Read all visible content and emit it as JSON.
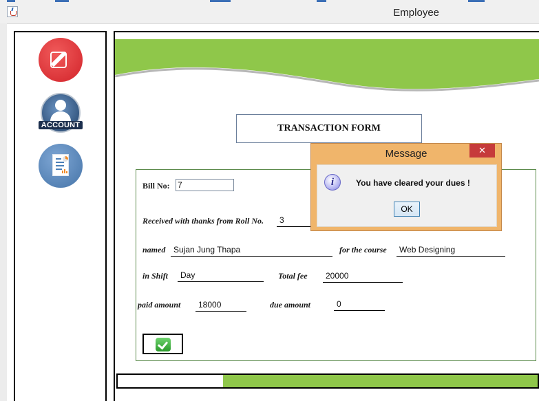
{
  "window": {
    "title": "Employee"
  },
  "sidebar": {
    "items": [
      {
        "name": "edit",
        "icon": "edit-icon"
      },
      {
        "name": "account",
        "icon": "account-icon",
        "label": "ACCOUNT"
      },
      {
        "name": "report",
        "icon": "report-icon"
      }
    ]
  },
  "form": {
    "title": "TRANSACTION FORM",
    "bill_label": "Bill No:",
    "bill_value": "7",
    "received_label": "Received with thanks from  Roll No.",
    "roll_value": "3",
    "named_label": "named",
    "name_value": "Sujan  Jung Thapa",
    "course_label": "for the course",
    "course_value": "Web Designing",
    "shift_label": "in Shift",
    "shift_value": "Day",
    "total_fee_label": "Total fee",
    "total_fee_value": "20000",
    "paid_label": "paid amount",
    "paid_value": "18000",
    "due_label": "due amount",
    "due_value": "0",
    "submit_icon": "check-icon"
  },
  "progress": {
    "fraction": 0.75
  },
  "dialog": {
    "title": "Message",
    "close_symbol": "✕",
    "message": "You have cleared your dues !",
    "ok_label": "OK",
    "info_symbol": "i"
  },
  "colors": {
    "accent_green": "#8fc74a",
    "dialog_frame": "#f0b56b",
    "close_red": "#c63b3b"
  }
}
